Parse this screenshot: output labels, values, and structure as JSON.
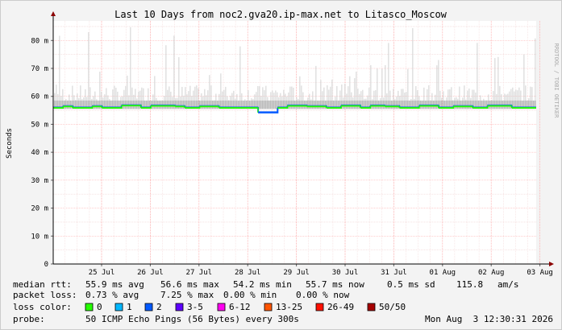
{
  "chart_data": {
    "type": "line",
    "title": "Last 10 Days from noc2.gva20.ip-max.net to Litasco_Moscow",
    "ylabel": "Seconds",
    "watermark": "RRDTOOL / TOBI OETIKER",
    "y_ticks": [
      "0",
      "10 m",
      "20 m",
      "30 m",
      "40 m",
      "50 m",
      "60 m",
      "70 m",
      "80 m"
    ],
    "ylim": [
      0,
      87
    ],
    "x_tick_labels": [
      "25 Jul",
      "26 Jul",
      "27 Jul",
      "28 Jul",
      "29 Jul",
      "30 Jul",
      "31 Jul",
      "01 Aug",
      "02 Aug",
      "03 Aug"
    ],
    "grid": true,
    "median_rtt_series": [
      {
        "x": 0.0,
        "y": 55.9
      },
      {
        "x": 0.2,
        "y": 56.4
      },
      {
        "x": 0.4,
        "y": 55.9
      },
      {
        "x": 0.8,
        "y": 56.4
      },
      {
        "x": 1.0,
        "y": 55.9
      },
      {
        "x": 1.4,
        "y": 56.7
      },
      {
        "x": 1.8,
        "y": 55.9
      },
      {
        "x": 2.0,
        "y": 56.6
      },
      {
        "x": 2.5,
        "y": 56.4
      },
      {
        "x": 2.7,
        "y": 55.9
      },
      {
        "x": 3.0,
        "y": 56.4
      },
      {
        "x": 3.4,
        "y": 55.9
      },
      {
        "x": 4.0,
        "y": 55.9
      },
      {
        "x": 4.2,
        "y": 54.2
      },
      {
        "x": 4.6,
        "y": 55.9
      },
      {
        "x": 4.8,
        "y": 56.6
      },
      {
        "x": 5.2,
        "y": 56.4
      },
      {
        "x": 5.6,
        "y": 55.9
      },
      {
        "x": 5.9,
        "y": 56.6
      },
      {
        "x": 6.3,
        "y": 55.9
      },
      {
        "x": 6.5,
        "y": 56.6
      },
      {
        "x": 6.8,
        "y": 56.4
      },
      {
        "x": 7.1,
        "y": 55.9
      },
      {
        "x": 7.5,
        "y": 56.6
      },
      {
        "x": 7.9,
        "y": 55.9
      },
      {
        "x": 8.2,
        "y": 56.4
      },
      {
        "x": 8.6,
        "y": 55.9
      },
      {
        "x": 8.9,
        "y": 56.6
      },
      {
        "x": 9.4,
        "y": 55.9
      },
      {
        "x": 9.9,
        "y": 55.9
      }
    ],
    "smoke_band": {
      "low": 55.5,
      "high_typical": 64,
      "high_max": 85
    },
    "stats": {
      "median_rtt": {
        "label": "median rtt:",
        "avg": "55.9 ms avg",
        "max": "56.6 ms max",
        "min": "54.2 ms min",
        "now": "55.7 ms now",
        "sd": "0.5 ms sd",
        "am": "115.8",
        "am_unit": "am/s"
      },
      "packet_loss": {
        "label": "packet loss:",
        "avg": "0.73 % avg",
        "max": "7.25 % max",
        "min": "0.00 % min",
        "now": "0.00 % now"
      }
    },
    "loss_color": {
      "label": "loss color:",
      "items": [
        {
          "label": "0",
          "color": "#26ff00"
        },
        {
          "label": "1",
          "color": "#00b8ff"
        },
        {
          "label": "2",
          "color": "#0059ff"
        },
        {
          "label": "3-5",
          "color": "#5e00ff"
        },
        {
          "label": "6-12",
          "color": "#ff00f0"
        },
        {
          "label": "13-25",
          "color": "#ff5500"
        },
        {
          "label": "26-49",
          "color": "#ff1000"
        },
        {
          "label": "50/50",
          "color": "#a60000"
        }
      ]
    },
    "probe": {
      "label": "probe:",
      "text": "50 ICMP Echo Pings (56 Bytes) every 300s",
      "timestamp": "Mon Aug  3 12:30:31 2026"
    }
  }
}
